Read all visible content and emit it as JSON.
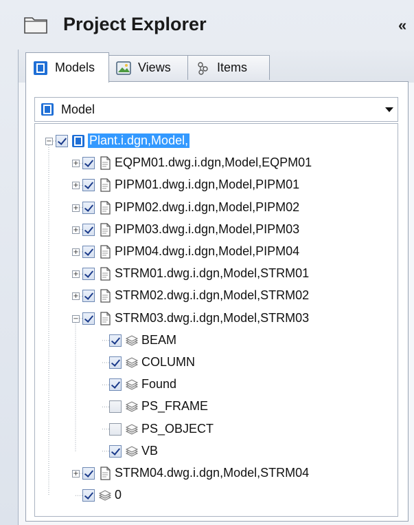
{
  "header": {
    "title": "Project Explorer",
    "collapse_label": "«"
  },
  "tabs": [
    {
      "label": "Models",
      "icon": "model-icon",
      "active": true
    },
    {
      "label": "Views",
      "icon": "views-icon",
      "active": false
    },
    {
      "label": "Items",
      "icon": "items-icon",
      "active": false
    }
  ],
  "dropdown": {
    "selected": "Model",
    "icon": "model-icon"
  },
  "tree": {
    "root": {
      "label": "Plant.i.dgn,Model,",
      "checked": true,
      "expanded": true,
      "selected": true,
      "icon": "model-icon"
    },
    "children": [
      {
        "label": "EQPM01.dwg.i.dgn,Model,EQPM01",
        "checked": true,
        "expanded": false,
        "icon": "file-icon"
      },
      {
        "label": "PIPM01.dwg.i.dgn,Model,PIPM01",
        "checked": true,
        "expanded": false,
        "icon": "file-icon"
      },
      {
        "label": "PIPM02.dwg.i.dgn,Model,PIPM02",
        "checked": true,
        "expanded": false,
        "icon": "file-icon"
      },
      {
        "label": "PIPM03.dwg.i.dgn,Model,PIPM03",
        "checked": true,
        "expanded": false,
        "icon": "file-icon"
      },
      {
        "label": "PIPM04.dwg.i.dgn,Model,PIPM04",
        "checked": true,
        "expanded": false,
        "icon": "file-icon"
      },
      {
        "label": "STRM01.dwg.i.dgn,Model,STRM01",
        "checked": true,
        "expanded": false,
        "icon": "file-icon"
      },
      {
        "label": "STRM02.dwg.i.dgn,Model,STRM02",
        "checked": true,
        "expanded": false,
        "icon": "file-icon"
      },
      {
        "label": "STRM03.dwg.i.dgn,Model,STRM03",
        "checked": true,
        "expanded": true,
        "icon": "file-icon",
        "children": [
          {
            "label": "BEAM",
            "checked": true,
            "icon": "layer-icon"
          },
          {
            "label": "COLUMN",
            "checked": true,
            "icon": "layer-icon"
          },
          {
            "label": "Found",
            "checked": true,
            "icon": "layer-icon"
          },
          {
            "label": "PS_FRAME",
            "checked": false,
            "icon": "layer-icon"
          },
          {
            "label": "PS_OBJECT",
            "checked": false,
            "icon": "layer-icon"
          },
          {
            "label": "VB",
            "checked": true,
            "icon": "layer-icon"
          }
        ]
      },
      {
        "label": "STRM04.dwg.i.dgn,Model,STRM04",
        "checked": true,
        "expanded": false,
        "icon": "file-icon"
      },
      {
        "label": "0",
        "checked": true,
        "icon": "layer-icon",
        "leaf": true
      }
    ]
  },
  "colors": {
    "selection": "#3399ff",
    "check": "#1a3a8a",
    "border": "#98a3b3"
  }
}
